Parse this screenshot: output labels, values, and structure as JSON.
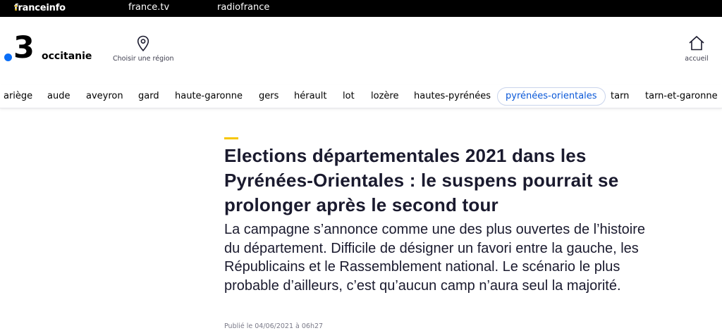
{
  "topbar": {
    "franceinfo_name": "franceinfo",
    "franceinfo_colon": ":",
    "francetv": "france.tv",
    "radiofrance": "radiofrance"
  },
  "header": {
    "logo_number": "3",
    "region_name": "occitanie",
    "choose_region_label": "Choisir une région",
    "home_label": "accueil"
  },
  "nav": {
    "items": [
      {
        "label": "ariège"
      },
      {
        "label": "aude"
      },
      {
        "label": "aveyron"
      },
      {
        "label": "gard"
      },
      {
        "label": "haute-garonne"
      },
      {
        "label": "gers"
      },
      {
        "label": "hérault"
      },
      {
        "label": "lot"
      },
      {
        "label": "lozère"
      },
      {
        "label": "hautes-pyrénées"
      },
      {
        "label": "pyrénées-orientales"
      },
      {
        "label": "tarn"
      },
      {
        "label": "tarn-et-garonne"
      }
    ],
    "active_item": "pyrénées-orientales"
  },
  "article": {
    "title": "Elections départementales 2021 dans les Pyrénées-Orientales : le suspens pourrait se prolonger après le second tour",
    "lead": "La campagne s’annonce comme une des plus ouvertes de l’histoire du département. Difficile de désigner un favori entre la gauche, les Républicains et le Rassemblement national. Le scénario le plus probable d’ailleurs, c’est qu’aucun camp n’aura seul la majorité.",
    "published": "Publié le 04/06/2021 à 06h27"
  },
  "colors": {
    "accent_yellow": "#f7c600",
    "logo_blue": "#0a6ef7",
    "active_nav_text": "#0a58d8",
    "topbar_bg": "#000000"
  },
  "icons": {
    "location": "location-pin-icon",
    "home": "home-icon"
  }
}
